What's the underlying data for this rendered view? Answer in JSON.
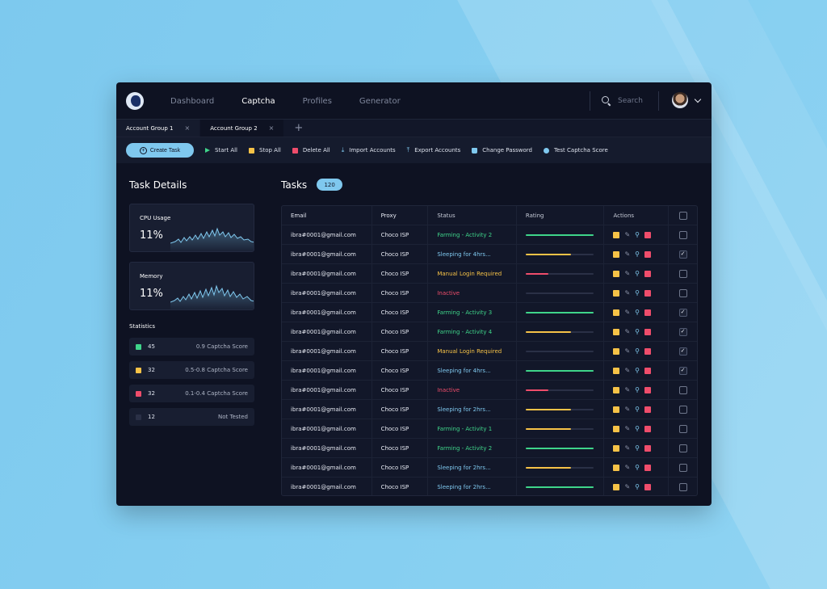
{
  "theme": {
    "bg": "#84cdf0",
    "panel": "#0e1222",
    "accent": "#7fc8ee",
    "green": "#3fd58a",
    "yellow": "#f6c247",
    "red": "#ef4d6b",
    "blue": "#7fc8ee"
  },
  "nav": {
    "items": [
      {
        "label": "Dashboard",
        "active": false
      },
      {
        "label": "Captcha",
        "active": true
      },
      {
        "label": "Profiles",
        "active": false
      },
      {
        "label": "Generator",
        "active": false
      }
    ],
    "search_placeholder": "Search"
  },
  "tabs": [
    {
      "label": "Account Group 1",
      "active": false
    },
    {
      "label": "Account Group 2",
      "active": true
    }
  ],
  "toolbar": {
    "create": "Create Task",
    "start_all": "Start All",
    "stop_all": "Stop All",
    "delete_all": "Delete All",
    "import": "Import Accounts",
    "export": "Export Accounts",
    "change_password": "Change Password",
    "test_captcha": "Test Captcha Score"
  },
  "left": {
    "title": "Task Details",
    "cpu": {
      "label": "CPU Usage",
      "value": "11%"
    },
    "memory": {
      "label": "Memory",
      "value": "11%"
    },
    "stats_title": "Statistics",
    "stats": [
      {
        "count": "45",
        "desc": "0.9 Captcha Score",
        "color": "#3fd58a"
      },
      {
        "count": "32",
        "desc": "0.5-0.8 Captcha Score",
        "color": "#f6c247"
      },
      {
        "count": "32",
        "desc": "0.1-0.4 Captcha Score",
        "color": "#ef4d6b"
      },
      {
        "count": "12",
        "desc": "Not Tested",
        "color": "#2a3046"
      }
    ]
  },
  "tasks": {
    "title": "Tasks",
    "count": "120",
    "headers": {
      "email": "Email",
      "proxy": "Proxy",
      "status": "Status",
      "rating": "Rating",
      "actions": "Actions"
    },
    "rows": [
      {
        "email": "ibra#0001@gmail.com",
        "proxy": "Choco ISP",
        "status": "Farming - Activity 2",
        "status_color": "#3fd58a",
        "rating": 1.0,
        "rating_color": "#3fd58a",
        "checked": false
      },
      {
        "email": "ibra#0001@gmail.com",
        "proxy": "Choco ISP",
        "status": "Sleeping for 4hrs...",
        "status_color": "#7fc8ee",
        "rating": 0.67,
        "rating_color": "#f6c247",
        "checked": true
      },
      {
        "email": "ibra#0001@gmail.com",
        "proxy": "Choco ISP",
        "status": "Manual Login Required",
        "status_color": "#f6c247",
        "rating": 0.33,
        "rating_color": "#ef4d6b",
        "checked": false
      },
      {
        "email": "ibra#0001@gmail.com",
        "proxy": "Choco ISP",
        "status": "Inactive",
        "status_color": "#ef4d6b",
        "rating": 0.0,
        "rating_color": "#2a3046",
        "checked": false
      },
      {
        "email": "ibra#0001@gmail.com",
        "proxy": "Choco ISP",
        "status": "Farming - Activity 3",
        "status_color": "#3fd58a",
        "rating": 1.0,
        "rating_color": "#3fd58a",
        "checked": true
      },
      {
        "email": "ibra#0001@gmail.com",
        "proxy": "Choco ISP",
        "status": "Farming - Activity 4",
        "status_color": "#3fd58a",
        "rating": 0.67,
        "rating_color": "#f6c247",
        "checked": true
      },
      {
        "email": "ibra#0001@gmail.com",
        "proxy": "Choco ISP",
        "status": "Manual Login Required",
        "status_color": "#f6c247",
        "rating": 0.0,
        "rating_color": "#2a3046",
        "checked": true
      },
      {
        "email": "ibra#0001@gmail.com",
        "proxy": "Choco ISP",
        "status": "Sleeping for 4hrs...",
        "status_color": "#7fc8ee",
        "rating": 1.0,
        "rating_color": "#3fd58a",
        "checked": true
      },
      {
        "email": "ibra#0001@gmail.com",
        "proxy": "Choco ISP",
        "status": "Inactive",
        "status_color": "#ef4d6b",
        "rating": 0.33,
        "rating_color": "#ef4d6b",
        "checked": false
      },
      {
        "email": "ibra#0001@gmail.com",
        "proxy": "Choco ISP",
        "status": "Sleeping for 2hrs...",
        "status_color": "#7fc8ee",
        "rating": 0.67,
        "rating_color": "#f6c247",
        "checked": false
      },
      {
        "email": "ibra#0001@gmail.com",
        "proxy": "Choco ISP",
        "status": "Farming - Activity 1",
        "status_color": "#3fd58a",
        "rating": 0.67,
        "rating_color": "#f6c247",
        "checked": false
      },
      {
        "email": "ibra#0001@gmail.com",
        "proxy": "Choco ISP",
        "status": "Farming - Activity 2",
        "status_color": "#3fd58a",
        "rating": 1.0,
        "rating_color": "#3fd58a",
        "checked": false
      },
      {
        "email": "ibra#0001@gmail.com",
        "proxy": "Choco ISP",
        "status": "Sleeping for 2hrs...",
        "status_color": "#7fc8ee",
        "rating": 0.67,
        "rating_color": "#f6c247",
        "checked": false
      },
      {
        "email": "ibra#0001@gmail.com",
        "proxy": "Choco ISP",
        "status": "Sleeping for 2hrs...",
        "status_color": "#7fc8ee",
        "rating": 1.0,
        "rating_color": "#3fd58a",
        "checked": false
      }
    ]
  }
}
